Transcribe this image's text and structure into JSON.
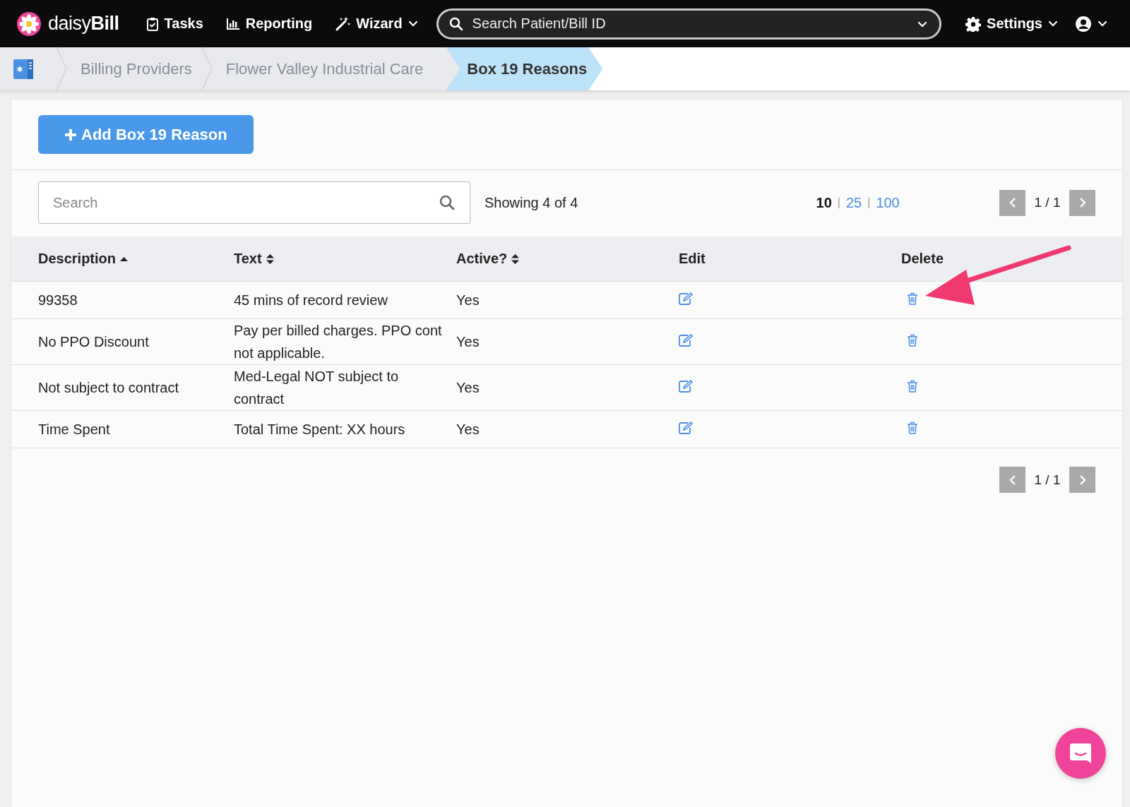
{
  "nav": {
    "brand": "daisy**Bill**",
    "items": [
      {
        "kind": "tasks",
        "label": "Tasks",
        "dropdown": false
      },
      {
        "kind": "reporting",
        "label": "Reporting",
        "dropdown": false
      },
      {
        "kind": "wizard",
        "label": "Wizard",
        "dropdown": true
      }
    ],
    "search": {
      "placeholder": "Search Patient/Bill ID"
    },
    "settings": {
      "label": "Settings",
      "dropdown": true
    }
  },
  "breadcrumb": [
    {
      "label": "Billing Providers",
      "selected": false
    },
    {
      "label": "Flower Valley Industrial Care",
      "selected": false
    },
    {
      "label": "Box 19 Reasons",
      "selected": true
    }
  ],
  "add_button": "Add Box 19 Reason",
  "search": {
    "placeholder": "Search"
  },
  "showing": "Showing 4 of 4",
  "page_sizes": [
    {
      "label": "10",
      "selected": true
    },
    {
      "separator": "|",
      "label": "25",
      "selected": false
    },
    {
      "separator": "|",
      "label": "100",
      "selected": false
    }
  ],
  "pager_top": "1 / 1",
  "table": {
    "columns": [
      {
        "label": "Description",
        "sortable": true,
        "sorted_ascending": true
      },
      {
        "label": "Text",
        "sortable": true,
        "sorted_ascending": false
      },
      {
        "label": "Active?",
        "sortable": true,
        "sorted_ascending": false
      },
      {
        "label": "Edit",
        "sortable": false
      },
      {
        "label": "Delete",
        "sortable": false
      }
    ],
    "rows": [
      {
        "description": "99358",
        "text": "45 mins of record review",
        "active": "Yes"
      },
      {
        "description": "No PPO Discount",
        "text": "Pay per billed charges. PPO cont not applicable.",
        "active": "Yes"
      },
      {
        "description": "Not subject to contract",
        "text": "Med-Legal NOT subject to contract",
        "active": "Yes"
      },
      {
        "description": "Time Spent",
        "text": "Total Time Spent: XX hours",
        "active": "Yes"
      }
    ]
  },
  "pager_bottom": "1 / 1"
}
